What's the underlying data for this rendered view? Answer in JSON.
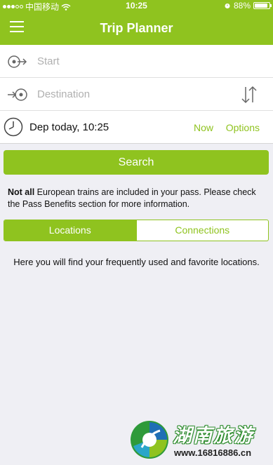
{
  "status_bar": {
    "carrier": "中国移动",
    "time": "10:25",
    "battery": "88%",
    "battery_level": 0.88
  },
  "header": {
    "title": "Trip Planner"
  },
  "form": {
    "start_placeholder": "Start",
    "destination_placeholder": "Destination",
    "departure_label": "Dep today, 10:25",
    "now_label": "Now",
    "options_label": "Options"
  },
  "search_button": "Search",
  "notice": {
    "bold": "Not all",
    "rest": " European trains are included in your pass. Please check the Pass Benefits section for more information."
  },
  "tabs": [
    {
      "label": "Locations",
      "active": true
    },
    {
      "label": "Connections",
      "active": false
    }
  ],
  "info_text": "Here you will find your frequently used and favorite locations.",
  "watermark": {
    "title": "湖南旅游",
    "url": "www.16816886.cn"
  },
  "colors": {
    "accent": "#8fc31f",
    "background": "#efeff4"
  }
}
